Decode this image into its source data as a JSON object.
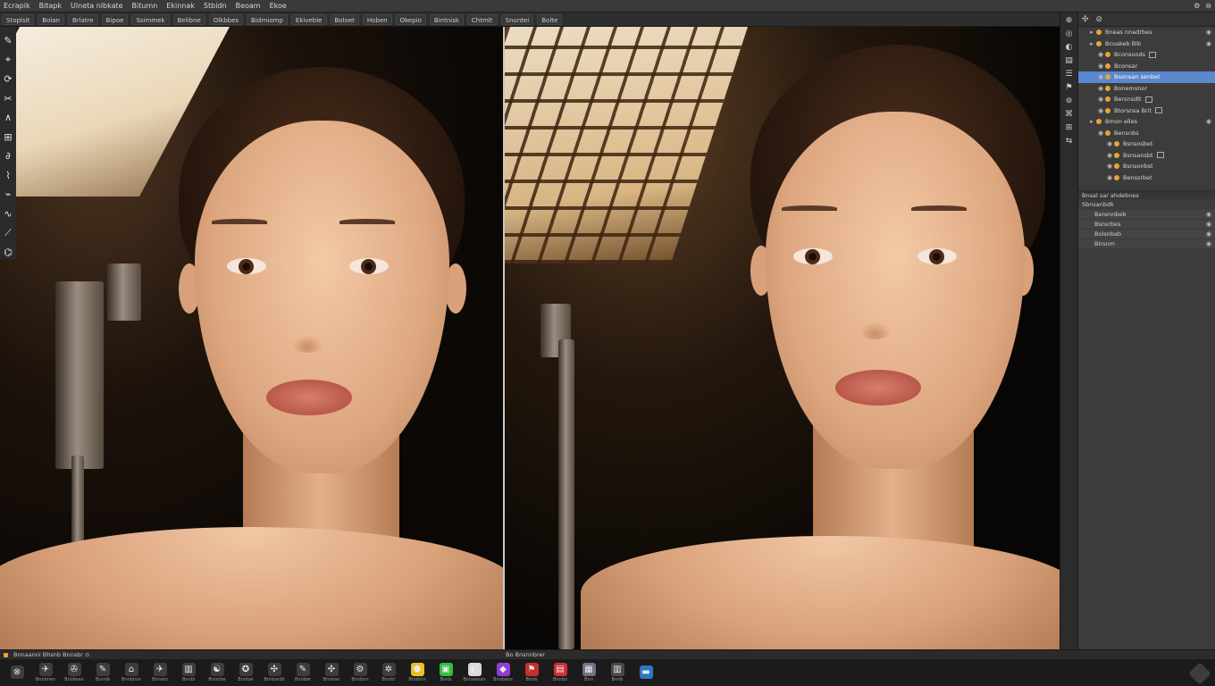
{
  "menubar": {
    "items": [
      "Ecrapik",
      "Bitapk",
      "Ulneta nibkate",
      "Bitumn",
      "Ekinnak",
      "Stbidn",
      "Beoam",
      "Ekoe"
    ],
    "window_controls": [
      "⚙",
      "⊖"
    ]
  },
  "options_bar": {
    "items": [
      "Stoplsit",
      "Bolan",
      "Brlatre",
      "Bipoe",
      "Ssimmek",
      "Belibne",
      "Olkbbes",
      "Bidrniomp",
      "Ekiveble",
      "Boloet",
      "Hoben",
      "Okepio",
      "Bintnisk",
      "Chtmlt",
      "Snuntei",
      "Bolte"
    ]
  },
  "toolbox": {
    "tools": [
      "✎",
      "⌖",
      "⟳",
      "✂",
      "∧",
      "⊞",
      "∂",
      "⌇",
      "⌁",
      "∿",
      "⟋",
      "⌬"
    ]
  },
  "icon_strip": {
    "icons": [
      "⊕",
      "◎",
      "◐",
      "▤",
      "☰",
      "⚑",
      "⊚",
      "⌘",
      "⊞",
      "⇆"
    ]
  },
  "layers_panel": {
    "tabs": [
      "✣",
      "⊘"
    ],
    "rows": [
      {
        "label": "Bneas nnadrbes",
        "indent": 1,
        "type": "header",
        "visible": true,
        "selected": false
      },
      {
        "label": "Bcoakeb Bib",
        "indent": 1,
        "type": "group",
        "visible": true,
        "selected": false
      },
      {
        "label": "Bconsoods",
        "indent": 2,
        "type": "layer",
        "visible": false,
        "selected": false,
        "mask": true
      },
      {
        "label": "Bconsar",
        "indent": 2,
        "type": "layer",
        "visible": false,
        "selected": false
      },
      {
        "label": "Bsonsan senbet",
        "indent": 2,
        "type": "layer",
        "visible": false,
        "selected": true
      },
      {
        "label": "Bonemsnor",
        "indent": 2,
        "type": "layer",
        "visible": false,
        "selected": false
      },
      {
        "label": "Bersnsdlt",
        "indent": 2,
        "type": "layer",
        "visible": false,
        "selected": false,
        "mask": true
      },
      {
        "label": "Btorsnsa Brit",
        "indent": 2,
        "type": "layer",
        "visible": false,
        "selected": false,
        "mask": true
      },
      {
        "label": "Bmon elles",
        "indent": 1,
        "type": "group",
        "visible": true,
        "selected": false
      },
      {
        "label": "Bensnbs",
        "indent": 2,
        "type": "layer",
        "visible": false,
        "selected": false
      },
      {
        "label": "Bsnsosbet",
        "indent": 3,
        "type": "layer",
        "visible": false,
        "selected": false
      },
      {
        "label": "Bsnsansbt",
        "indent": 3,
        "type": "layer",
        "visible": false,
        "selected": false,
        "mask": true
      },
      {
        "label": "Bsnsonbst",
        "indent": 3,
        "type": "layer",
        "visible": false,
        "selected": false
      },
      {
        "label": "Benssrbet",
        "indent": 3,
        "type": "layer",
        "visible": false,
        "selected": false
      }
    ],
    "adjust_header": "Bnsal sar ahdebnes",
    "props_header": "Sbnsanbdk",
    "props": [
      "Berennbeb",
      "Bsnsrbes",
      "Bolsnbab",
      "Birsnm"
    ]
  },
  "status_bar": {
    "left": "Bnnaanni Bhsnb Bnnsbr ⊙",
    "mid": "Bo Bnsnnbrer"
  },
  "taskbar": {
    "items": [
      {
        "icon": "⊗",
        "label": "",
        "color": "#3d3d3d"
      },
      {
        "icon": "✈",
        "label": "Bnnbnen",
        "color": "#3d3d3d"
      },
      {
        "icon": "✇",
        "label": "Bnobsan",
        "color": "#3d3d3d"
      },
      {
        "icon": "✎",
        "label": "Bunnb",
        "color": "#3d3d3d"
      },
      {
        "icon": "⌂",
        "label": "Bnnbnsn",
        "color": "#3d3d3d"
      },
      {
        "icon": "✈",
        "label": "Bnnaro",
        "color": "#3d3d3d"
      },
      {
        "icon": "▥",
        "label": "Bnnbi",
        "color": "#3d3d3d"
      },
      {
        "icon": "☯",
        "label": "Bnnnbe",
        "color": "#3d3d3d"
      },
      {
        "icon": "✪",
        "label": "Bnnbal",
        "color": "#3d3d3d"
      },
      {
        "icon": "✣",
        "label": "Bnnbarbt",
        "color": "#3d3d3d"
      },
      {
        "icon": "✎",
        "label": "Bnnbar",
        "color": "#3d3d3d"
      },
      {
        "icon": "✣",
        "label": "Bnnkan",
        "color": "#3d3d3d"
      },
      {
        "icon": "⚙",
        "label": "Bnnbnn",
        "color": "#3d3d3d"
      },
      {
        "icon": "✲",
        "label": "Bnnbr",
        "color": "#3d3d3d"
      },
      {
        "icon": "⬢",
        "label": "Bnnbnn",
        "color": "#e8c21c"
      },
      {
        "icon": "▣",
        "label": "Bnnb",
        "color": "#2fbe3a"
      },
      {
        "icon": "◧",
        "label": "Bnnaanan",
        "color": "#d9d9d9"
      },
      {
        "icon": "◆",
        "label": "Bnnbans",
        "color": "#8f3fd1"
      },
      {
        "icon": "⚑",
        "label": "Bnnb",
        "color": "#c4312d"
      },
      {
        "icon": "▤",
        "label": "Bnnbn",
        "color": "#d12d3a"
      },
      {
        "icon": "▦",
        "label": "Bnn",
        "color": "#6f6f86"
      },
      {
        "icon": "▥",
        "label": "Bnnb",
        "color": "#4a4a4a"
      },
      {
        "icon": "▬",
        "label": "",
        "color": "#2d77c9"
      }
    ]
  },
  "colors": {
    "selection": "#5b87cd",
    "layer_dot": "#e7a637",
    "panel_bg": "#3c3c3c"
  }
}
